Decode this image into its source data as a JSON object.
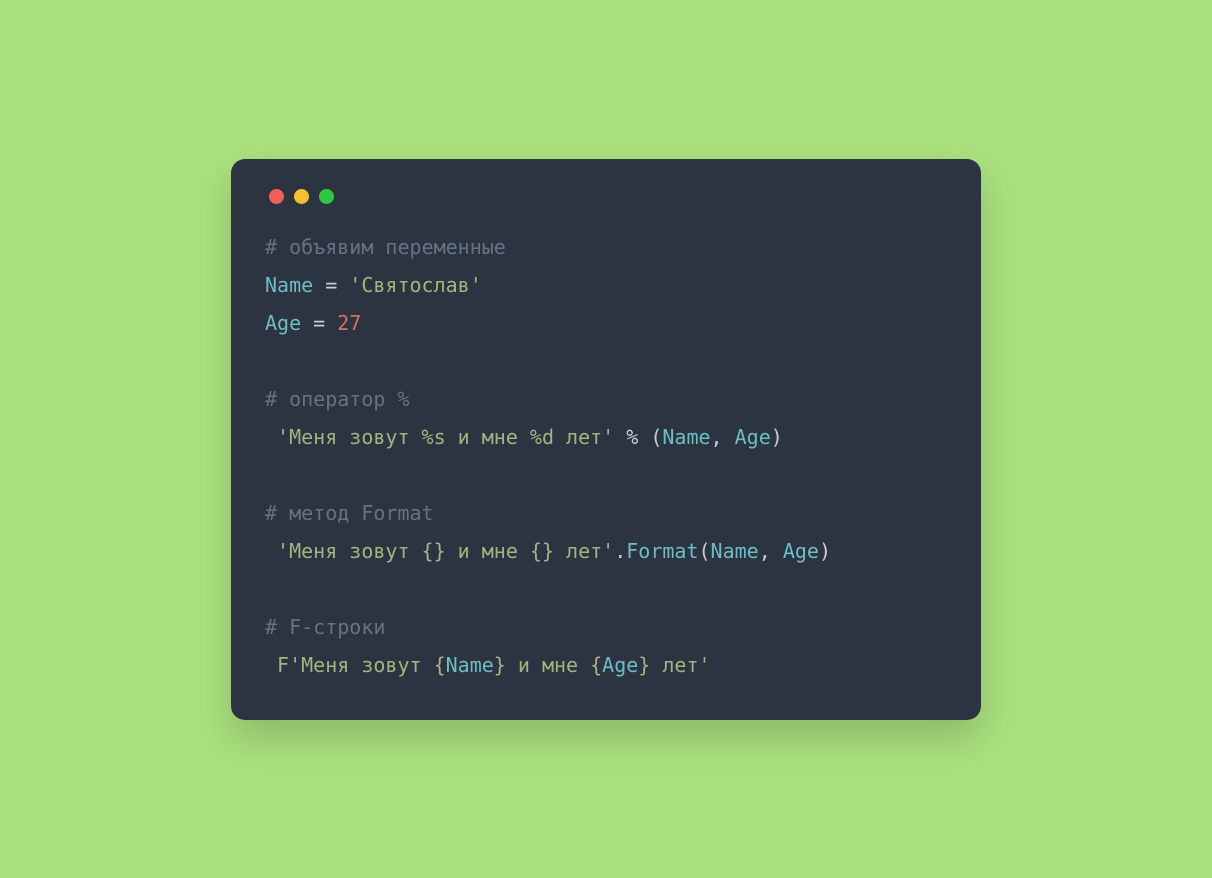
{
  "window": {
    "traffic_lights": {
      "close": "#f25f57",
      "minimize": "#f7be2f",
      "zoom": "#30c841"
    }
  },
  "code": {
    "lines": [
      {
        "kind": "comment",
        "t": "# объявим переменные"
      },
      {
        "kind": "assign",
        "var": "Name",
        "eq": " = ",
        "val_kind": "string",
        "val": "'Святослав'"
      },
      {
        "kind": "assign",
        "var": "Age",
        "eq": " = ",
        "val_kind": "num",
        "val": "27"
      },
      {
        "kind": "blank"
      },
      {
        "kind": "comment",
        "t": "# оператор %"
      },
      {
        "kind": "pct",
        "str": " 'Меня зовут %s и мне %d лет' ",
        "op": "% (",
        "a": "Name",
        "sep": ", ",
        "b": "Age",
        "close": ")"
      },
      {
        "kind": "blank"
      },
      {
        "kind": "comment",
        "t": "# метод Format"
      },
      {
        "kind": "fmt",
        "str": " 'Меня зовут {} и мне {} лет'",
        "dot": ".",
        "fn": "Format",
        "open": "(",
        "a": "Name",
        "sep": ", ",
        "b": "Age",
        "close": ")"
      },
      {
        "kind": "blank"
      },
      {
        "kind": "comment",
        "t": "# F-строки"
      },
      {
        "kind": "fstr"
      }
    ],
    "fstr": {
      "head": " F'Меня зовут {",
      "a": "Name",
      "mid": "} и мне {",
      "b": "Age",
      "tail": "} лет'"
    }
  }
}
